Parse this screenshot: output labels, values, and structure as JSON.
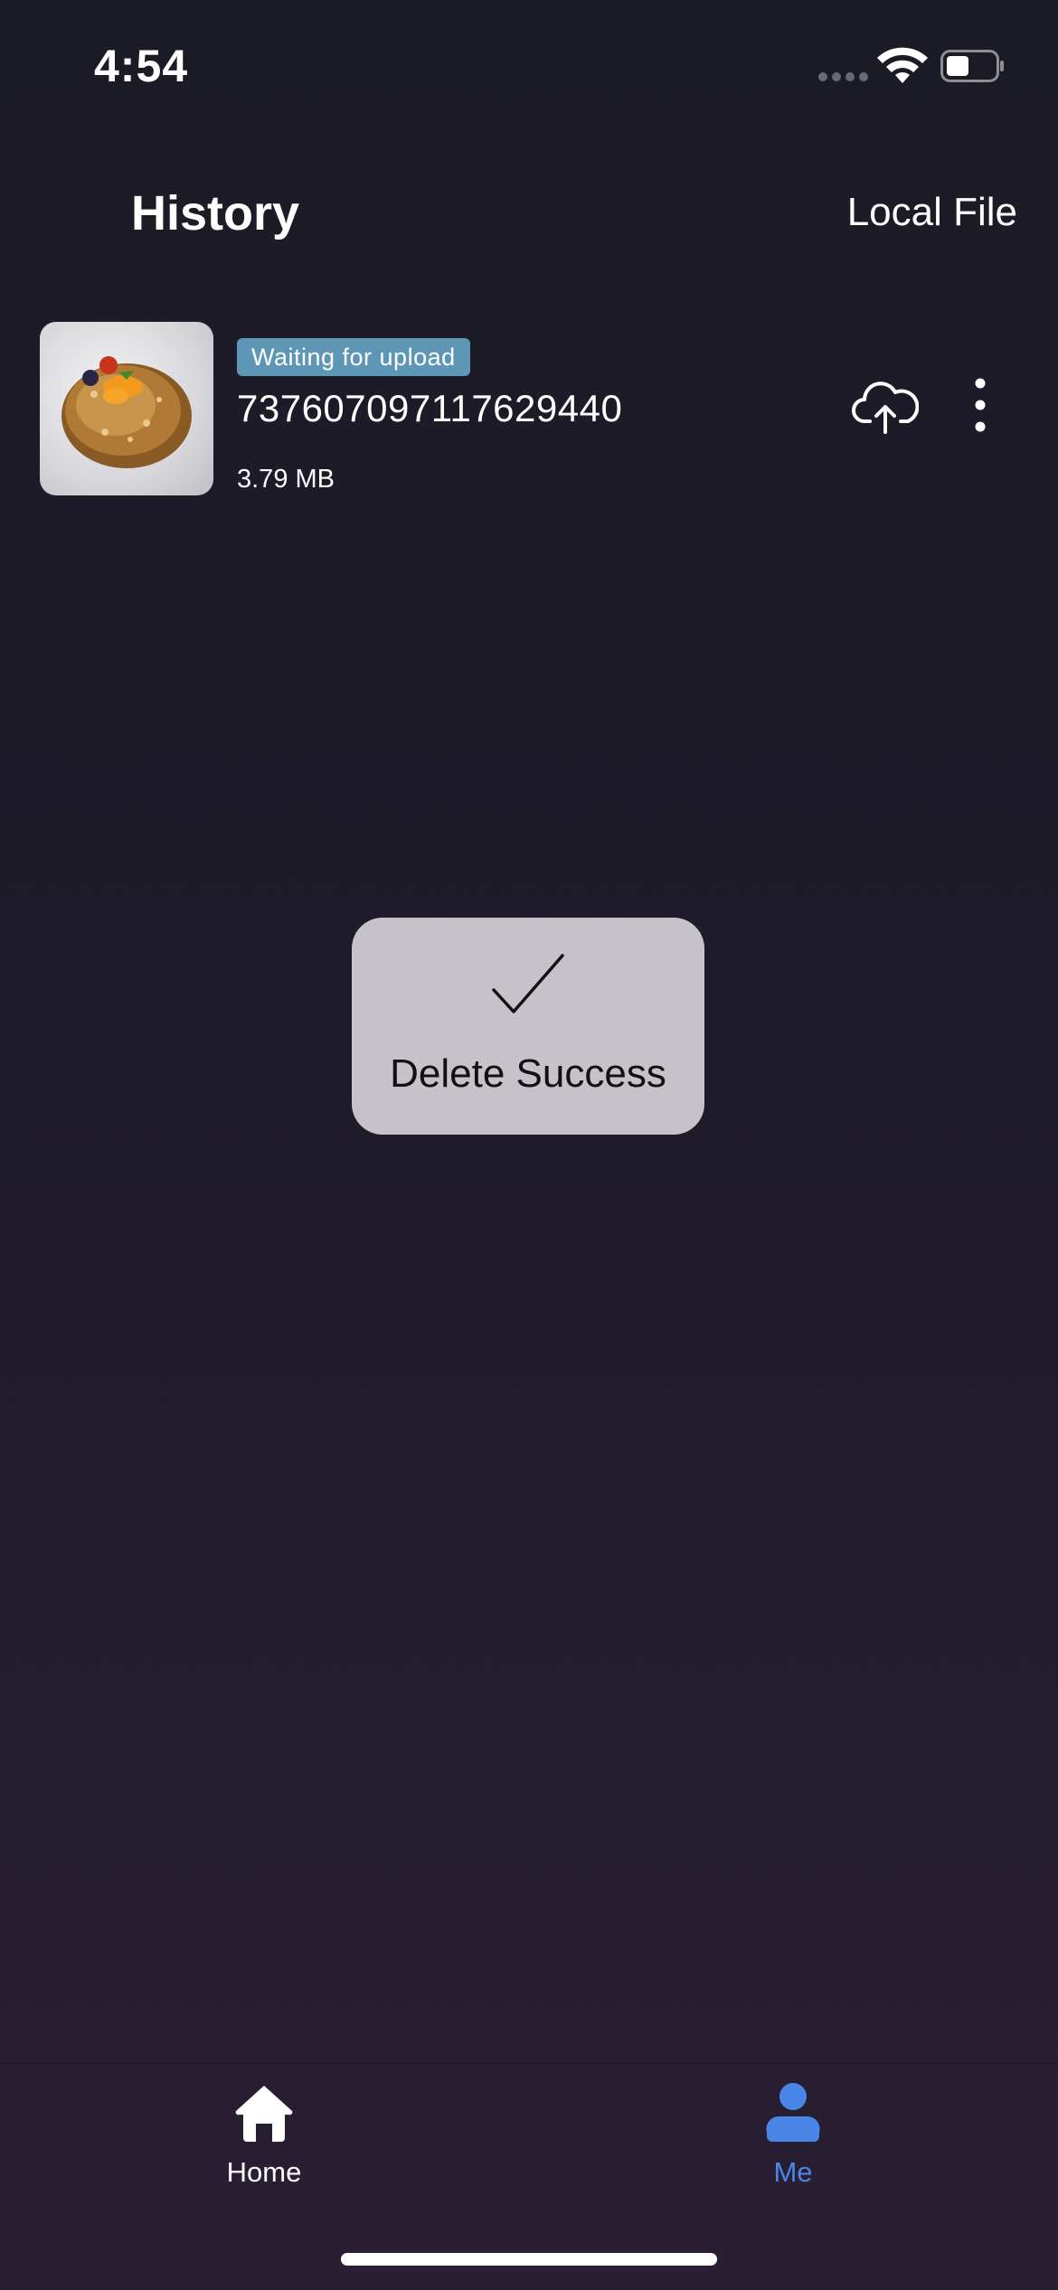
{
  "status_bar": {
    "time": "4:54"
  },
  "header": {
    "title": "History",
    "local_file_label": "Local File"
  },
  "history": {
    "items": [
      {
        "status": "Waiting for upload",
        "name": "737607097117629440",
        "size": "3.79 MB"
      }
    ]
  },
  "toast": {
    "message": "Delete Success"
  },
  "tab_bar": {
    "tabs": [
      {
        "label": "Home",
        "icon": "home-icon",
        "active": false
      },
      {
        "label": "Me",
        "icon": "person-icon",
        "active": true
      }
    ]
  },
  "colors": {
    "background": "#1b1b25",
    "badge": "#5e97b6",
    "accent": "#4a86e8",
    "toast": "#c7c2c9"
  }
}
